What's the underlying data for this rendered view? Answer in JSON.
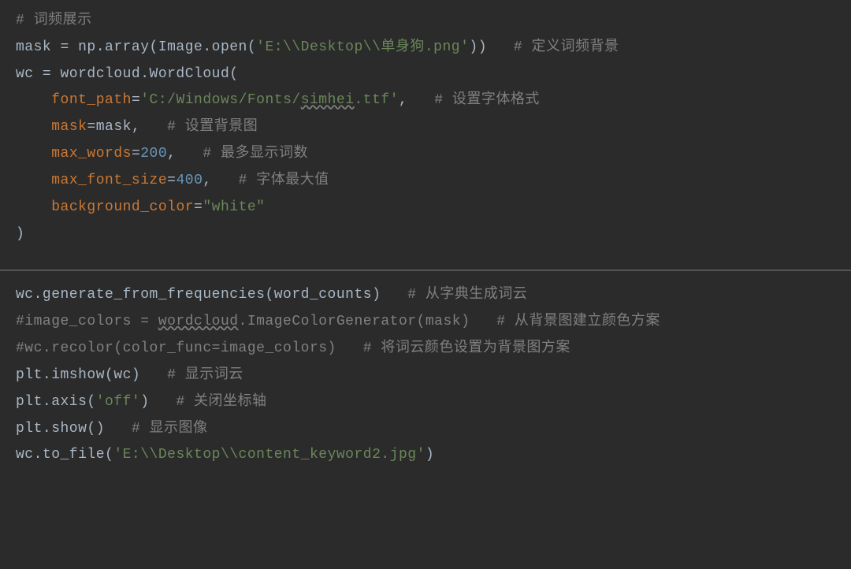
{
  "code": {
    "block1": {
      "l1_comment": "# 词频展示",
      "l2_a": "mask = np.array(Image.open(",
      "l2_str": "'E:\\\\Desktop\\\\单身狗.png'",
      "l2_b": "))   ",
      "l2_comment": "# 定义词频背景",
      "l3": "wc = wordcloud.WordCloud(",
      "l4_indent": "    ",
      "l4_param": "font_path",
      "l4_eq": "=",
      "l4_str_a": "'C:/Windows/Fonts/",
      "l4_str_wavy": "simhei",
      "l4_str_b": ".ttf'",
      "l4_comma": ",   ",
      "l4_comment": "# 设置字体格式",
      "l5_indent": "    ",
      "l5_param": "mask",
      "l5_rest": "=mask,   ",
      "l5_comment": "# 设置背景图",
      "l6_indent": "    ",
      "l6_param": "max_words",
      "l6_eq": "=",
      "l6_num": "200",
      "l6_comma": ",   ",
      "l6_comment": "# 最多显示词数",
      "l7_indent": "    ",
      "l7_param": "max_font_size",
      "l7_eq": "=",
      "l7_num": "400",
      "l7_comma": ",   ",
      "l7_comment": "# 字体最大值",
      "l8_indent": "    ",
      "l8_param": "background_color",
      "l8_eq": "=",
      "l8_str": "\"white\"",
      "l9": ")"
    },
    "block2": {
      "l1_a": "wc.generate_from_frequencies(word_counts)   ",
      "l1_comment": "# 从字典生成词云",
      "l2_a": "#image_colors = ",
      "l2_wavy": "wordcloud",
      "l2_b": ".ImageColorGenerator(mask)   # 从背景图建立颜色方案",
      "l3": "#wc.recolor(color_func=image_colors)   # 将词云颜色设置为背景图方案",
      "l4_a": "plt.imshow(wc)   ",
      "l4_comment": "# 显示词云",
      "l5_a": "plt.axis(",
      "l5_str": "'off'",
      "l5_b": ")   ",
      "l5_comment": "# 关闭坐标轴",
      "l6_a": "plt.show()   ",
      "l6_comment": "# 显示图像",
      "l7_a": "wc.to_file(",
      "l7_str": "'E:\\\\Desktop\\\\content_keyword2.jpg'",
      "l7_b": ")"
    }
  }
}
